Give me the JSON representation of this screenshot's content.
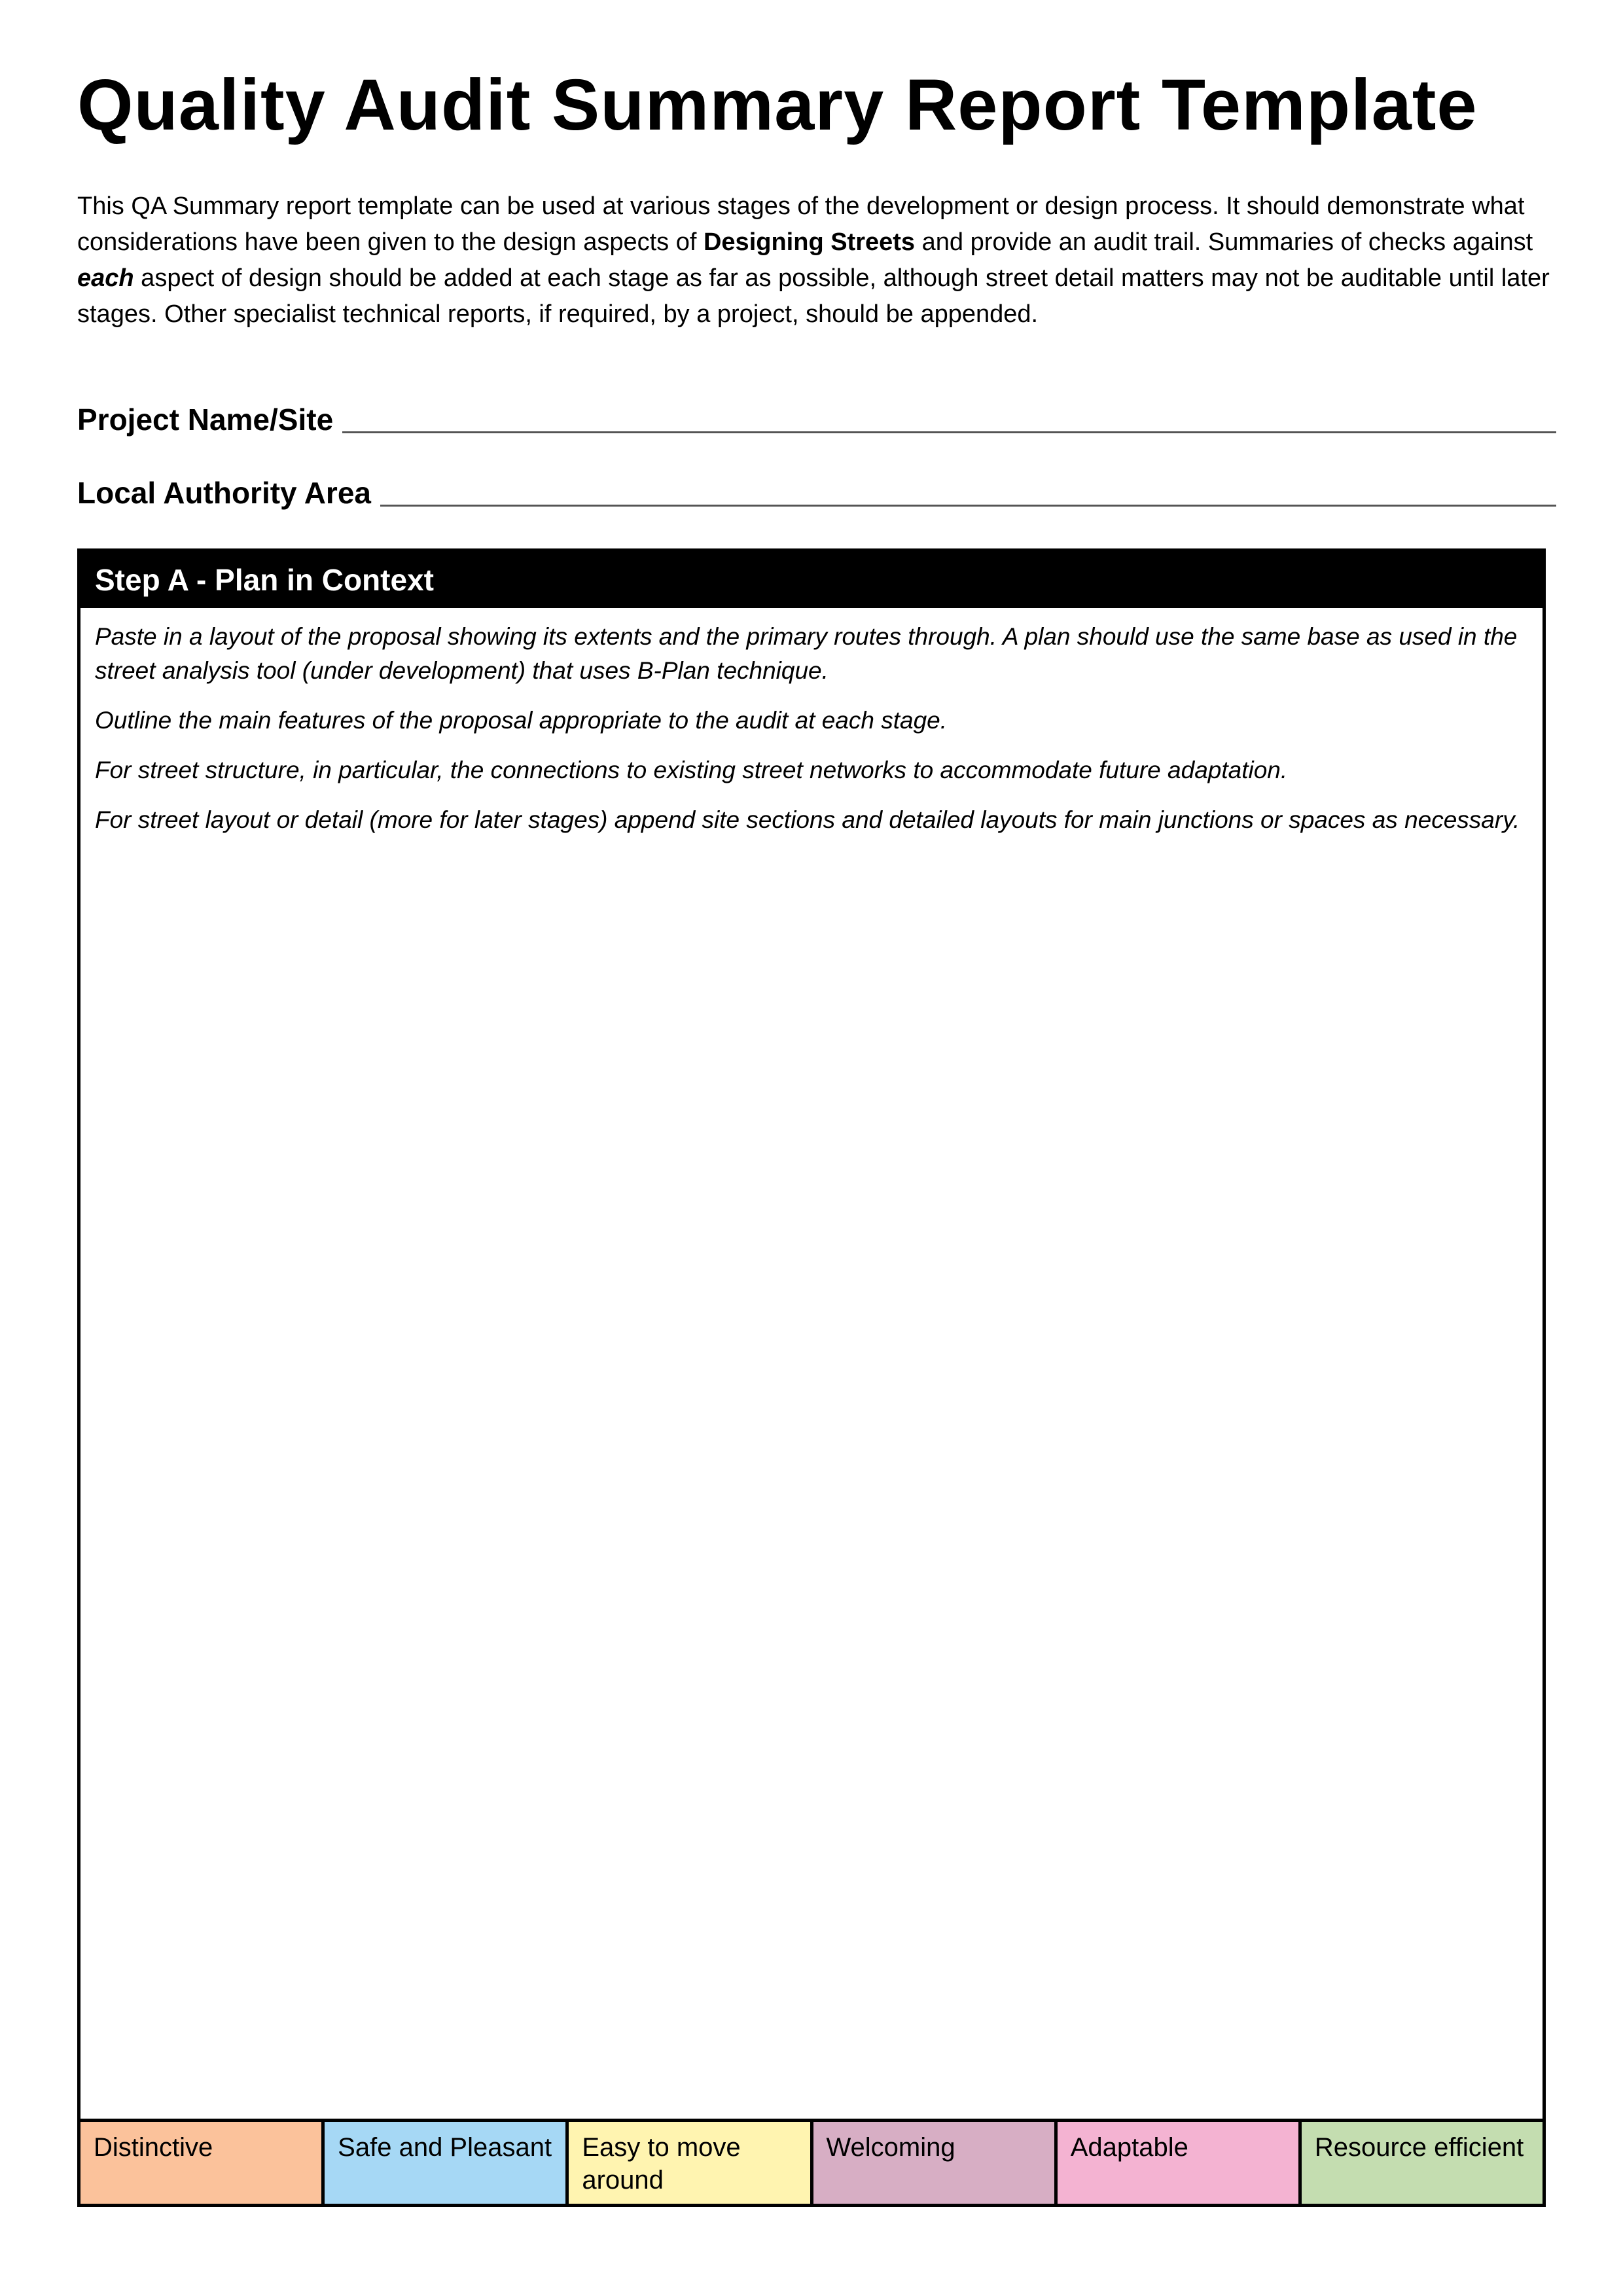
{
  "title": "Quality Audit Summary Report Template",
  "intro": {
    "part1": "This QA Summary report template can be used at various stages of the development or design process.  It should demonstrate what considerations have been given to the design aspects of ",
    "bold1": "Designing Streets",
    "part2": " and provide an audit trail. Summaries of checks against ",
    "bold2": "each",
    "part3": " aspect of design should be added at each stage as far as possible, although street detail matters may not be auditable until later stages.  Other specialist technical reports, if required, by a project, should be appended."
  },
  "fields": {
    "project_name_label": "Project Name/Site",
    "project_name_value": "",
    "local_authority_label": "Local Authority Area",
    "local_authority_value": ""
  },
  "step": {
    "heading": "Step A - Plan in Context",
    "paragraphs": [
      "Paste in a layout of the proposal showing its extents and the primary routes through.  A plan should use the same base as used in the street analysis tool (under development) that uses B-Plan technique.",
      "Outline the main features of the proposal appropriate to the audit at each stage.",
      "For street structure, in particular, the connections to existing street networks to accommodate future adaptation.",
      "For street layout or detail (more for later stages) append site sections and detailed layouts for main junctions or spaces as necessary."
    ]
  },
  "qualities": [
    {
      "label": "Distinctive",
      "color": "#fbc29b"
    },
    {
      "label": "Safe and Pleasant",
      "color": "#a6d8f5"
    },
    {
      "label": "Easy to move around",
      "color": "#fff4b0"
    },
    {
      "label": "Welcoming",
      "color": "#d7aec4"
    },
    {
      "label": "Adaptable",
      "color": "#f4b3d2"
    },
    {
      "label": "Resource efficient",
      "color": "#c4ddb0"
    }
  ]
}
